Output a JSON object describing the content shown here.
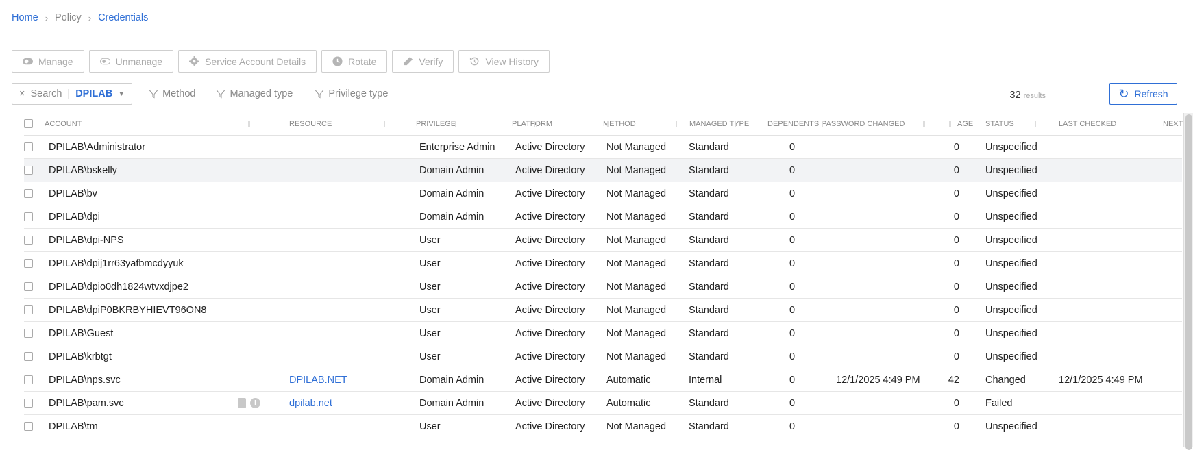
{
  "breadcrumb": {
    "home": "Home",
    "policy": "Policy",
    "current": "Credentials",
    "separator": ">"
  },
  "toolbar": {
    "manage": "Manage",
    "unmanage": "Unmanage",
    "service_account_details": "Service Account Details",
    "rotate": "Rotate",
    "verify": "Verify",
    "view_history": "View History"
  },
  "filters": {
    "clear": "×",
    "search_label": "Search",
    "search_value": "DPILAB",
    "method": "Method",
    "managed_type": "Managed type",
    "privilege_type": "Privilege type"
  },
  "results": {
    "count": "32",
    "label": "results"
  },
  "refresh_label": "Refresh",
  "colors": {
    "accent": "#2f6fd6",
    "hover_row": "#f2f3f5"
  },
  "columns": [
    "Account",
    "Resource",
    "Privilege",
    "Platform",
    "Method",
    "Managed type",
    "Dependents",
    "Password changed",
    "Age",
    "Status",
    "Last checked",
    "Next"
  ],
  "rows": [
    {
      "account": "DPILAB\\Administrator",
      "resource": "",
      "privilege": "Enterprise Admin",
      "platform": "Active Directory",
      "method": "Not Managed",
      "managed_type": "Standard",
      "dependents": "0",
      "password_changed": "",
      "age": "0",
      "status": "Unspecified",
      "last_checked": ""
    },
    {
      "account": "DPILAB\\bskelly",
      "resource": "",
      "privilege": "Domain Admin",
      "platform": "Active Directory",
      "method": "Not Managed",
      "managed_type": "Standard",
      "dependents": "0",
      "password_changed": "",
      "age": "0",
      "status": "Unspecified",
      "last_checked": "",
      "hover": true
    },
    {
      "account": "DPILAB\\bv",
      "resource": "",
      "privilege": "Domain Admin",
      "platform": "Active Directory",
      "method": "Not Managed",
      "managed_type": "Standard",
      "dependents": "0",
      "password_changed": "",
      "age": "0",
      "status": "Unspecified",
      "last_checked": ""
    },
    {
      "account": "DPILAB\\dpi",
      "resource": "",
      "privilege": "Domain Admin",
      "platform": "Active Directory",
      "method": "Not Managed",
      "managed_type": "Standard",
      "dependents": "0",
      "password_changed": "",
      "age": "0",
      "status": "Unspecified",
      "last_checked": ""
    },
    {
      "account": "DPILAB\\dpi-NPS",
      "resource": "",
      "privilege": "User",
      "platform": "Active Directory",
      "method": "Not Managed",
      "managed_type": "Standard",
      "dependents": "0",
      "password_changed": "",
      "age": "0",
      "status": "Unspecified",
      "last_checked": ""
    },
    {
      "account": "DPILAB\\dpij1rr63yafbmcdyyuk",
      "resource": "",
      "privilege": "User",
      "platform": "Active Directory",
      "method": "Not Managed",
      "managed_type": "Standard",
      "dependents": "0",
      "password_changed": "",
      "age": "0",
      "status": "Unspecified",
      "last_checked": ""
    },
    {
      "account": "DPILAB\\dpio0dh1824wtvxdjpe2",
      "resource": "",
      "privilege": "User",
      "platform": "Active Directory",
      "method": "Not Managed",
      "managed_type": "Standard",
      "dependents": "0",
      "password_changed": "",
      "age": "0",
      "status": "Unspecified",
      "last_checked": ""
    },
    {
      "account": "DPILAB\\dpiP0BKRBYHIEVT96ON8",
      "resource": "",
      "privilege": "User",
      "platform": "Active Directory",
      "method": "Not Managed",
      "managed_type": "Standard",
      "dependents": "0",
      "password_changed": "",
      "age": "0",
      "status": "Unspecified",
      "last_checked": ""
    },
    {
      "account": "DPILAB\\Guest",
      "resource": "",
      "privilege": "User",
      "platform": "Active Directory",
      "method": "Not Managed",
      "managed_type": "Standard",
      "dependents": "0",
      "password_changed": "",
      "age": "0",
      "status": "Unspecified",
      "last_checked": ""
    },
    {
      "account": "DPILAB\\krbtgt",
      "resource": "",
      "privilege": "User",
      "platform": "Active Directory",
      "method": "Not Managed",
      "managed_type": "Standard",
      "dependents": "0",
      "password_changed": "",
      "age": "0",
      "status": "Unspecified",
      "last_checked": ""
    },
    {
      "account": "DPILAB\\nps.svc",
      "resource": "DPILAB.NET",
      "privilege": "Domain Admin",
      "platform": "Active Directory",
      "method": "Automatic",
      "managed_type": "Internal",
      "dependents": "0",
      "password_changed": "12/1/2025 4:49 PM",
      "age": "42",
      "status": "Changed",
      "last_checked": "12/1/2025 4:49 PM"
    },
    {
      "account": "DPILAB\\pam.svc",
      "resource": "dpilab.net",
      "privilege": "Domain Admin",
      "platform": "Active Directory",
      "method": "Automatic",
      "managed_type": "Standard",
      "dependents": "0",
      "password_changed": "",
      "age": "0",
      "status": "Failed",
      "last_checked": "",
      "row_icons": true
    },
    {
      "account": "DPILAB\\tm",
      "resource": "",
      "privilege": "User",
      "platform": "Active Directory",
      "method": "Not Managed",
      "managed_type": "Standard",
      "dependents": "0",
      "password_changed": "",
      "age": "0",
      "status": "Unspecified",
      "last_checked": ""
    }
  ]
}
